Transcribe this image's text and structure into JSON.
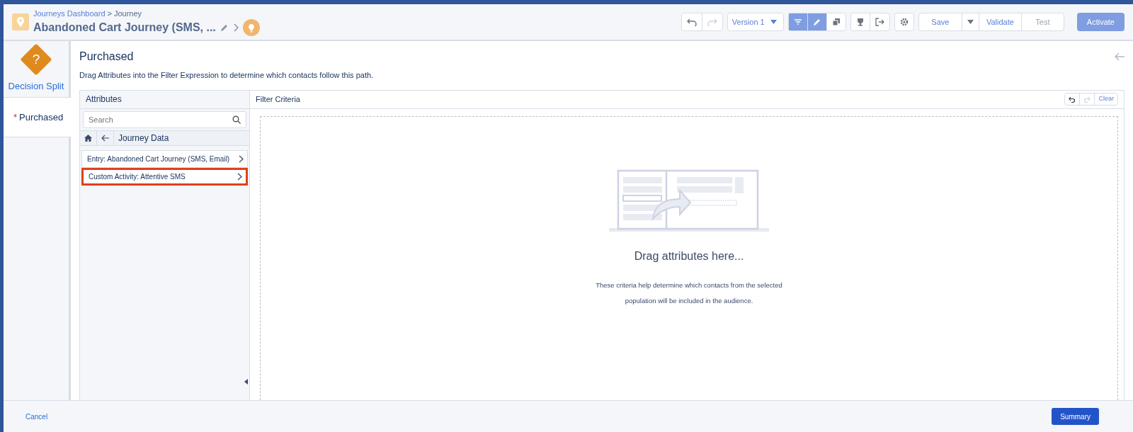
{
  "header": {
    "breadcrumb": [
      {
        "label": "Journeys Dashboard",
        "link": true
      },
      {
        "label": "Journey",
        "link": false
      }
    ],
    "breadcrumb_separator": ">",
    "title": "Abandoned Cart Journey (SMS, ...",
    "version": "Version 1",
    "buttons": [
      {
        "label": "Save",
        "disabled": false
      },
      {
        "label": "Validate",
        "disabled": false
      },
      {
        "label": "Test",
        "disabled": true
      }
    ],
    "activate": "Activate"
  },
  "sidebar": {
    "activity": "Decision Split",
    "activity_symbol": "?",
    "required_marker": "*",
    "tabs": [
      {
        "label": "Purchased",
        "required": true,
        "selected": true
      }
    ]
  },
  "panel": {
    "title": "Purchased",
    "description": "Drag Attributes into the Filter Expression to determine which contacts follow this path.",
    "attributes": {
      "title": "Attributes",
      "search": {
        "placeholder": "Search"
      },
      "path": "Journey Data",
      "items": [
        {
          "label": "Entry: Abandoned Cart Journey (SMS, Email)",
          "highlighted": false
        },
        {
          "label": "Custom Activity: Attentive SMS",
          "highlighted": true
        }
      ]
    },
    "filter": {
      "title": "Filter Criteria",
      "clear": "Clear",
      "empty_title": "Drag attributes here...",
      "empty_text": "These criteria help determine which contacts from the selected population will be included in the audience."
    }
  },
  "footer": {
    "cancel": "Cancel",
    "summary": "Summary"
  }
}
